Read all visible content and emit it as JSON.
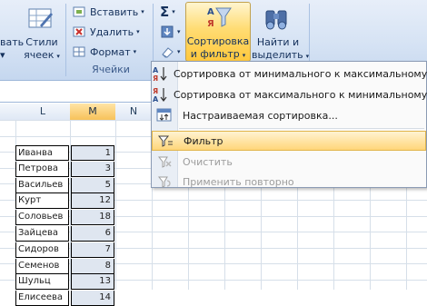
{
  "ribbon": {
    "styles_group": {
      "fragment_label": "вать",
      "fragment_arrow": "▾",
      "cell_styles_label_1": "Стили",
      "cell_styles_label_2": "ячеек"
    },
    "cells_group": {
      "insert_label": "Вставить",
      "delete_label": "Удалить",
      "format_label": "Формат",
      "group_label": "Ячейки"
    },
    "editing_group": {
      "sigma_symbol": "Σ",
      "sort_filter_label_1": "Сортировка",
      "sort_filter_label_2": "и фильтр",
      "find_select_label_1": "Найти и",
      "find_select_label_2": "выделить"
    }
  },
  "sheet": {
    "columns": [
      "L",
      "M",
      "N"
    ],
    "active_column": "M",
    "rows": [
      {
        "name": "Иванва",
        "value": "1"
      },
      {
        "name": "Петрова",
        "value": "3"
      },
      {
        "name": "Васильев",
        "value": "5"
      },
      {
        "name": "Курт",
        "value": "12"
      },
      {
        "name": "Соловьев",
        "value": "18"
      },
      {
        "name": "Зайцева",
        "value": "6"
      },
      {
        "name": "Сидоров",
        "value": "7"
      },
      {
        "name": "Семенов",
        "value": "8"
      },
      {
        "name": "Шульц",
        "value": "13"
      },
      {
        "name": "Елисеева",
        "value": "14"
      }
    ]
  },
  "menu": {
    "items": [
      {
        "label": "Сортировка от минимального к максимальному",
        "icon": "sort-ascending-icon",
        "state": "normal"
      },
      {
        "label": "Сортировка от максимального к минимальному",
        "icon": "sort-descending-icon",
        "state": "normal"
      },
      {
        "label": "Настраиваемая сортировка...",
        "icon": "custom-sort-icon",
        "state": "normal"
      },
      {
        "label": "Фильтр",
        "icon": "filter-icon",
        "state": "highlighted"
      },
      {
        "label": "Очистить",
        "icon": "clear-filter-icon",
        "state": "disabled"
      },
      {
        "label": "Применить повторно",
        "icon": "reapply-filter-icon",
        "state": "disabled"
      }
    ]
  },
  "colors": {
    "ribbon_bg": "#d6e3f4",
    "highlight": "#ffd67a",
    "disabled_text": "#9d9d9d"
  }
}
